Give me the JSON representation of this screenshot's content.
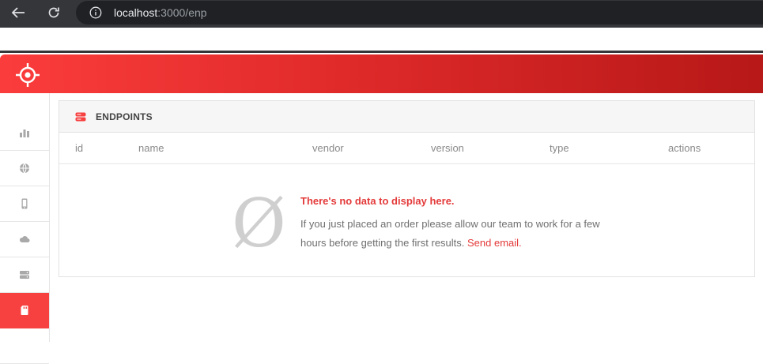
{
  "browser": {
    "url_host": "localhost",
    "url_path": ":3000/enp"
  },
  "icons": {
    "back": "back-arrow-icon",
    "reload": "reload-icon",
    "info": "info-icon",
    "logo": "crosshair-target-logo",
    "panel": "server-stack-icon"
  },
  "colors": {
    "accent": "#f74040",
    "header_start": "#fb3c3c",
    "header_end": "#b71818",
    "link": "#e43a3a"
  },
  "sidebar": {
    "items": [
      {
        "name": "stats",
        "icon": "bar-chart-icon",
        "active": false
      },
      {
        "name": "web",
        "icon": "globe-icon",
        "active": false
      },
      {
        "name": "mobile",
        "icon": "mobile-phone-icon",
        "active": false
      },
      {
        "name": "cloud",
        "icon": "cloud-icon",
        "active": false
      },
      {
        "name": "servers",
        "icon": "server-icon",
        "active": false
      },
      {
        "name": "endpoints",
        "icon": "sd-card-icon",
        "active": true
      }
    ]
  },
  "panel": {
    "title": "ENDPOINTS",
    "columns": [
      "id",
      "name",
      "vendor",
      "version",
      "type",
      "actions"
    ]
  },
  "empty_state": {
    "symbol": "Ø",
    "title": "There's no data to display here.",
    "text": "If you just placed an order please allow our team to work for a few hours before getting the first results.",
    "link": "Send email."
  }
}
